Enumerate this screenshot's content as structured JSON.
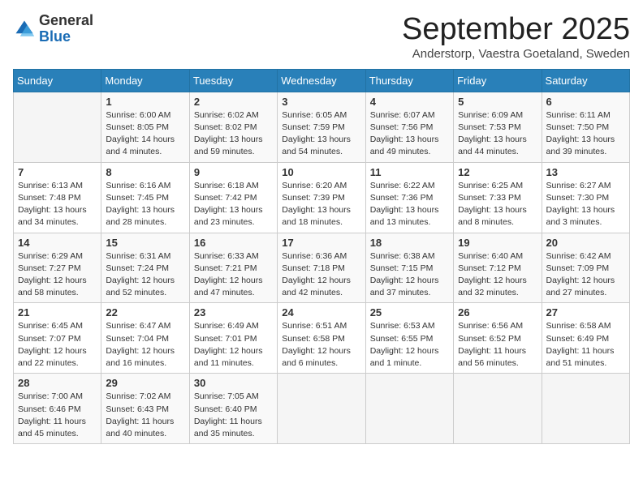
{
  "header": {
    "logo_general": "General",
    "logo_blue": "Blue",
    "month_title": "September 2025",
    "location": "Anderstorp, Vaestra Goetaland, Sweden"
  },
  "columns": [
    "Sunday",
    "Monday",
    "Tuesday",
    "Wednesday",
    "Thursday",
    "Friday",
    "Saturday"
  ],
  "weeks": [
    [
      {
        "day": "",
        "info": ""
      },
      {
        "day": "1",
        "info": "Sunrise: 6:00 AM\nSunset: 8:05 PM\nDaylight: 14 hours\nand 4 minutes."
      },
      {
        "day": "2",
        "info": "Sunrise: 6:02 AM\nSunset: 8:02 PM\nDaylight: 13 hours\nand 59 minutes."
      },
      {
        "day": "3",
        "info": "Sunrise: 6:05 AM\nSunset: 7:59 PM\nDaylight: 13 hours\nand 54 minutes."
      },
      {
        "day": "4",
        "info": "Sunrise: 6:07 AM\nSunset: 7:56 PM\nDaylight: 13 hours\nand 49 minutes."
      },
      {
        "day": "5",
        "info": "Sunrise: 6:09 AM\nSunset: 7:53 PM\nDaylight: 13 hours\nand 44 minutes."
      },
      {
        "day": "6",
        "info": "Sunrise: 6:11 AM\nSunset: 7:50 PM\nDaylight: 13 hours\nand 39 minutes."
      }
    ],
    [
      {
        "day": "7",
        "info": "Sunrise: 6:13 AM\nSunset: 7:48 PM\nDaylight: 13 hours\nand 34 minutes."
      },
      {
        "day": "8",
        "info": "Sunrise: 6:16 AM\nSunset: 7:45 PM\nDaylight: 13 hours\nand 28 minutes."
      },
      {
        "day": "9",
        "info": "Sunrise: 6:18 AM\nSunset: 7:42 PM\nDaylight: 13 hours\nand 23 minutes."
      },
      {
        "day": "10",
        "info": "Sunrise: 6:20 AM\nSunset: 7:39 PM\nDaylight: 13 hours\nand 18 minutes."
      },
      {
        "day": "11",
        "info": "Sunrise: 6:22 AM\nSunset: 7:36 PM\nDaylight: 13 hours\nand 13 minutes."
      },
      {
        "day": "12",
        "info": "Sunrise: 6:25 AM\nSunset: 7:33 PM\nDaylight: 13 hours\nand 8 minutes."
      },
      {
        "day": "13",
        "info": "Sunrise: 6:27 AM\nSunset: 7:30 PM\nDaylight: 13 hours\nand 3 minutes."
      }
    ],
    [
      {
        "day": "14",
        "info": "Sunrise: 6:29 AM\nSunset: 7:27 PM\nDaylight: 12 hours\nand 58 minutes."
      },
      {
        "day": "15",
        "info": "Sunrise: 6:31 AM\nSunset: 7:24 PM\nDaylight: 12 hours\nand 52 minutes."
      },
      {
        "day": "16",
        "info": "Sunrise: 6:33 AM\nSunset: 7:21 PM\nDaylight: 12 hours\nand 47 minutes."
      },
      {
        "day": "17",
        "info": "Sunrise: 6:36 AM\nSunset: 7:18 PM\nDaylight: 12 hours\nand 42 minutes."
      },
      {
        "day": "18",
        "info": "Sunrise: 6:38 AM\nSunset: 7:15 PM\nDaylight: 12 hours\nand 37 minutes."
      },
      {
        "day": "19",
        "info": "Sunrise: 6:40 AM\nSunset: 7:12 PM\nDaylight: 12 hours\nand 32 minutes."
      },
      {
        "day": "20",
        "info": "Sunrise: 6:42 AM\nSunset: 7:09 PM\nDaylight: 12 hours\nand 27 minutes."
      }
    ],
    [
      {
        "day": "21",
        "info": "Sunrise: 6:45 AM\nSunset: 7:07 PM\nDaylight: 12 hours\nand 22 minutes."
      },
      {
        "day": "22",
        "info": "Sunrise: 6:47 AM\nSunset: 7:04 PM\nDaylight: 12 hours\nand 16 minutes."
      },
      {
        "day": "23",
        "info": "Sunrise: 6:49 AM\nSunset: 7:01 PM\nDaylight: 12 hours\nand 11 minutes."
      },
      {
        "day": "24",
        "info": "Sunrise: 6:51 AM\nSunset: 6:58 PM\nDaylight: 12 hours\nand 6 minutes."
      },
      {
        "day": "25",
        "info": "Sunrise: 6:53 AM\nSunset: 6:55 PM\nDaylight: 12 hours\nand 1 minute."
      },
      {
        "day": "26",
        "info": "Sunrise: 6:56 AM\nSunset: 6:52 PM\nDaylight: 11 hours\nand 56 minutes."
      },
      {
        "day": "27",
        "info": "Sunrise: 6:58 AM\nSunset: 6:49 PM\nDaylight: 11 hours\nand 51 minutes."
      }
    ],
    [
      {
        "day": "28",
        "info": "Sunrise: 7:00 AM\nSunset: 6:46 PM\nDaylight: 11 hours\nand 45 minutes."
      },
      {
        "day": "29",
        "info": "Sunrise: 7:02 AM\nSunset: 6:43 PM\nDaylight: 11 hours\nand 40 minutes."
      },
      {
        "day": "30",
        "info": "Sunrise: 7:05 AM\nSunset: 6:40 PM\nDaylight: 11 hours\nand 35 minutes."
      },
      {
        "day": "",
        "info": ""
      },
      {
        "day": "",
        "info": ""
      },
      {
        "day": "",
        "info": ""
      },
      {
        "day": "",
        "info": ""
      }
    ]
  ]
}
